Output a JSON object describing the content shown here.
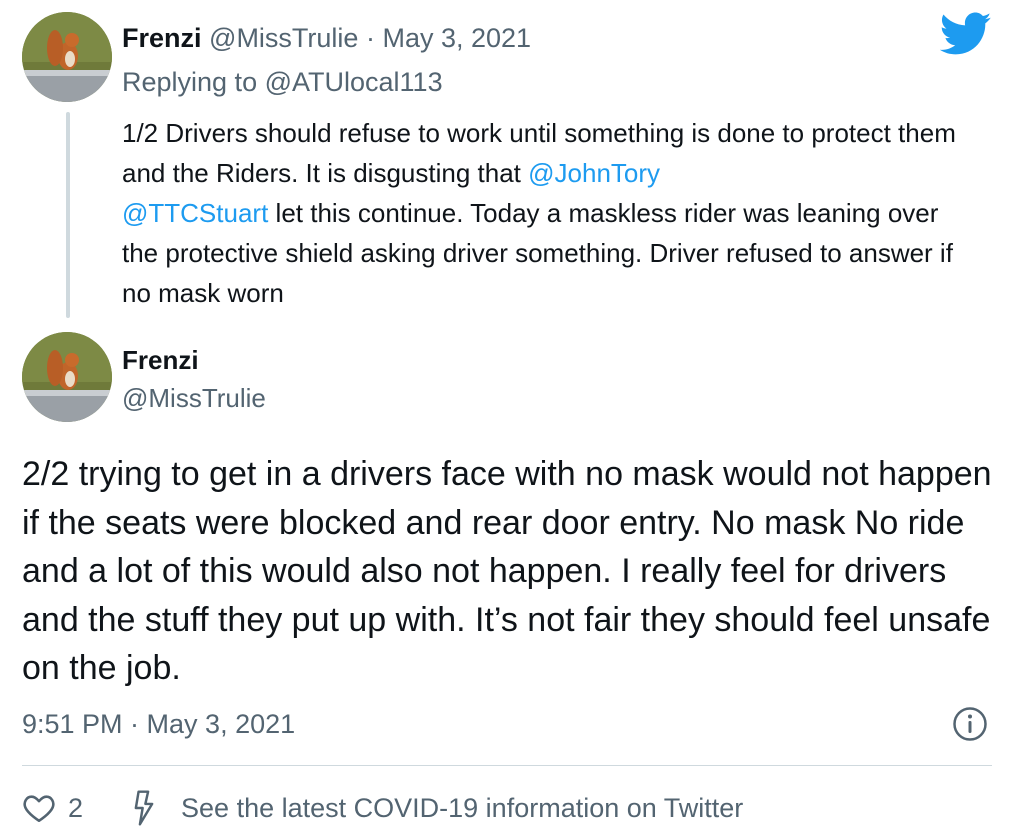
{
  "parent_tweet": {
    "avatar": "squirrel-avatar",
    "display_name": "Frenzi",
    "handle": "@MissTrulie",
    "separator": "·",
    "date": "May 3, 2021",
    "replying_prefix": "Replying to",
    "replying_to": "@ATUlocal113",
    "body": {
      "part1": "1/2 Drivers should refuse to work until something is done to protect them and the Riders. It is disgusting that ",
      "mention1": "@JohnTory",
      "mention2": "@TTCStuart",
      "part2": " let this continue. Today a maskless rider was leaning over the protective shield asking driver something. Driver refused to answer if no mask worn"
    }
  },
  "main_tweet": {
    "avatar": "squirrel-avatar",
    "display_name": "Frenzi",
    "handle": "@MissTrulie",
    "body": "2/2 trying to get in a drivers face with no mask would not happen if the seats were blocked and rear door entry. No mask No ride and a lot of this would also not happen. I really feel for drivers and the stuff they put up with. It’s not fair they should feel unsafe on the job.",
    "timestamp": "9:51 PM · May 3, 2021",
    "likes": "2",
    "covid_notice": "See the latest COVID-19 information on Twitter"
  },
  "icons": {
    "logo": "twitter-bird-icon",
    "info": "info-icon",
    "like": "heart-icon",
    "covid": "lightning-icon"
  },
  "colors": {
    "brand_blue": "#1d9bf0",
    "text": "#0f1419",
    "muted": "#536471",
    "border": "#cfd9de"
  }
}
